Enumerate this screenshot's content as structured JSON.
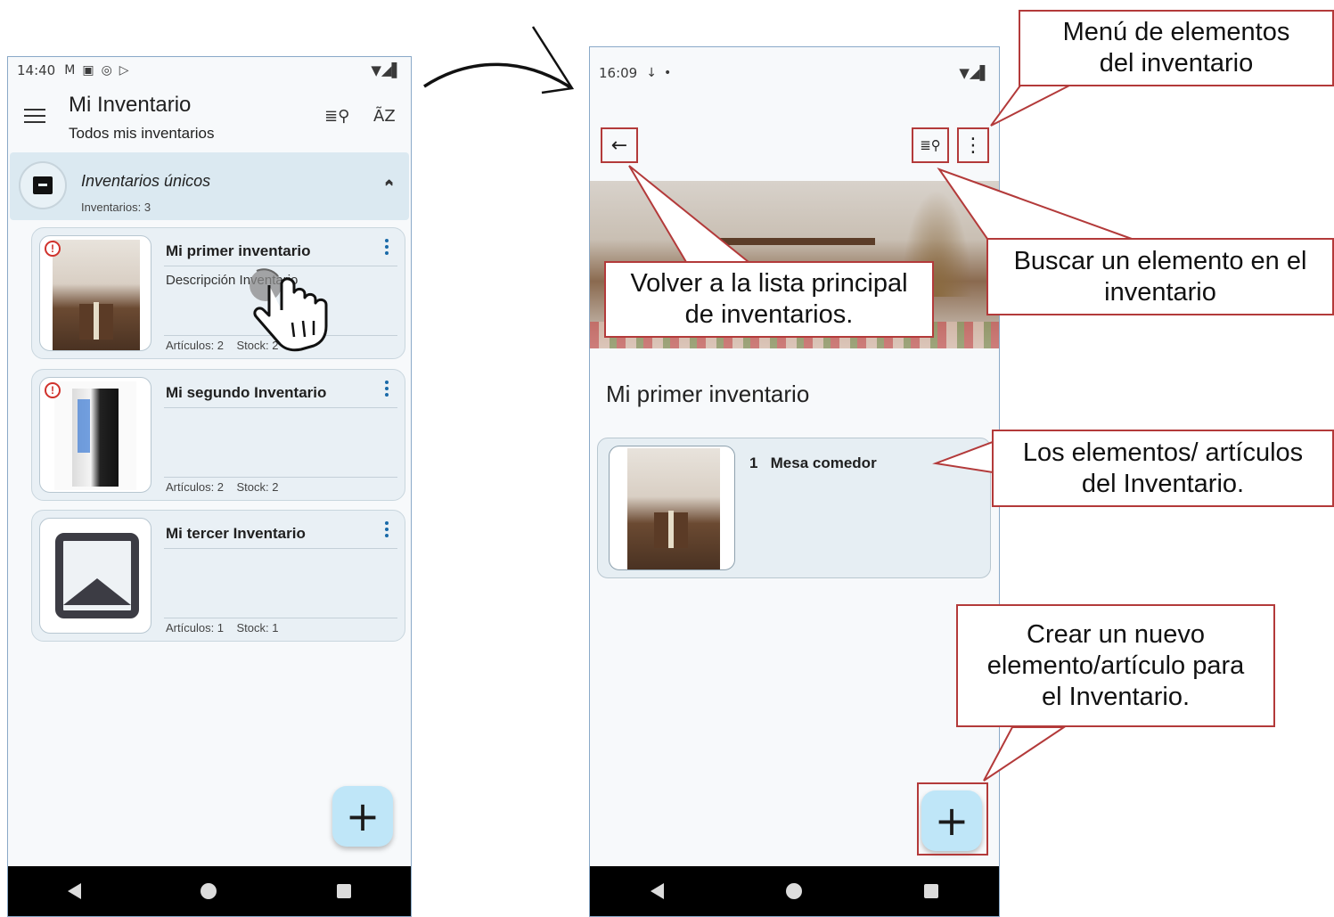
{
  "phone1": {
    "status": {
      "time": "14:40",
      "icons": [
        "M",
        "▣",
        "◎",
        "▷"
      ],
      "right": "▼◢▌"
    },
    "appbar": {
      "title": "Mi Inventario",
      "subtitle": "Todos mis inventarios",
      "search_icon": "≣⚲",
      "sort_label": "ÃZ"
    },
    "section": {
      "title": "Inventarios únicos",
      "count": "Inventarios: 3",
      "chevron": "⌃"
    },
    "inventories": [
      {
        "title": "Mi primer inventario",
        "description": "Descripción Inventario",
        "stats": "Artículos: 2    Stock: 2",
        "image": "room-photo",
        "alert": "!"
      },
      {
        "title": "Mi segundo Inventario",
        "description": "",
        "stats": "Artículos: 2    Stock: 2",
        "image": "pc-case-photo",
        "alert": "!"
      },
      {
        "title": "Mi tercer Inventario",
        "description": "",
        "stats": "Artículos: 1    Stock: 1",
        "image": "placeholder-image"
      }
    ],
    "fab_label": "+"
  },
  "phone2": {
    "status": {
      "time": "16:09",
      "icons": [
        "↓",
        "•"
      ],
      "right": "▼◢▌"
    },
    "back_icon": "←",
    "search_icon": "≣⚲",
    "menu_icon": "⋮",
    "inventory_name": "Mi primer inventario",
    "elements": [
      {
        "number": "1",
        "name": "Mesa comedor"
      }
    ],
    "fab_label": "+"
  },
  "callouts": {
    "menu": "Menú de elementos\ndel inventario",
    "search": "Buscar un elemento en el\ninventario",
    "back": "Volver a la lista principal\nde inventarios.",
    "elements": "Los elementos/ artículos\ndel Inventario.",
    "create": "Crear un nuevo\nelemento/artículo para\nel Inventario."
  },
  "colors": {
    "callout_border": "#b33a3a",
    "fab": "#bfe6f8",
    "section_header": "#dbe9f1",
    "card": "#e9f0f5"
  }
}
